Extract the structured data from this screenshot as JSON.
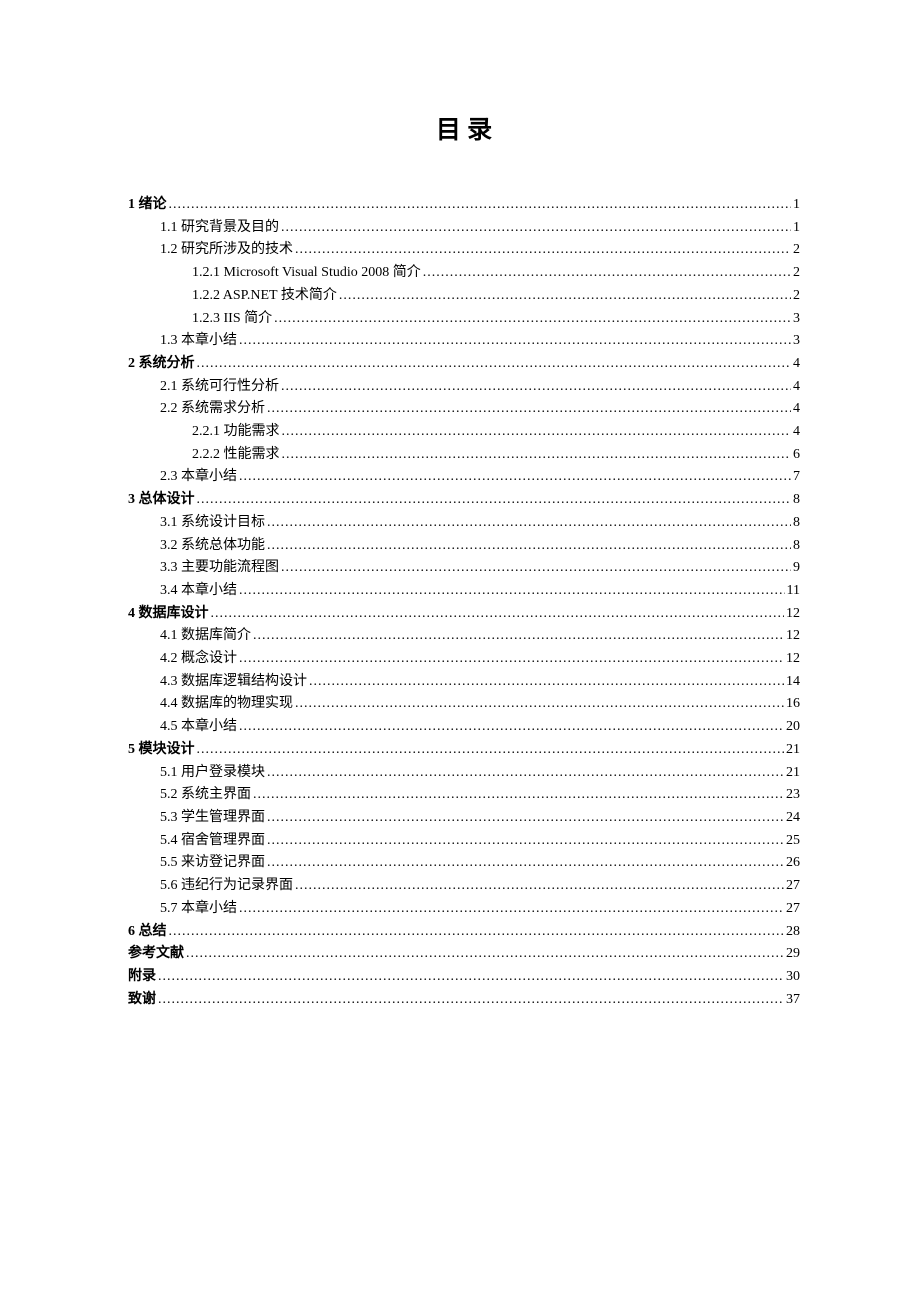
{
  "title": "目 录",
  "toc": [
    {
      "level": 0,
      "label": "1  绪论",
      "page": "1"
    },
    {
      "level": 1,
      "label": "1.1  研究背景及目的",
      "page": "1"
    },
    {
      "level": 1,
      "label": "1.2  研究所涉及的技术",
      "page": "2"
    },
    {
      "level": 2,
      "label": "1.2.1 Microsoft Visual Studio 2008 简介",
      "page": "2"
    },
    {
      "level": 2,
      "label": "1.2.2 ASP.NET 技术简介",
      "page": "2"
    },
    {
      "level": 2,
      "label": "1.2.3 IIS 简介",
      "page": "3"
    },
    {
      "level": 1,
      "label": "1.3  本章小结",
      "page": "3"
    },
    {
      "level": 0,
      "label": "2  系统分析",
      "page": "4"
    },
    {
      "level": 1,
      "label": "2.1  系统可行性分析",
      "page": "4"
    },
    {
      "level": 1,
      "label": "2.2  系统需求分析",
      "page": "4"
    },
    {
      "level": 2,
      "label": "2.2.1  功能需求",
      "page": "4"
    },
    {
      "level": 2,
      "label": "2.2.2  性能需求",
      "page": "6"
    },
    {
      "level": 1,
      "label": "2.3  本章小结",
      "page": "7"
    },
    {
      "level": 0,
      "label": "3  总体设计",
      "page": "8"
    },
    {
      "level": 1,
      "label": "3.1  系统设计目标",
      "page": "8"
    },
    {
      "level": 1,
      "label": "3.2  系统总体功能",
      "page": "8"
    },
    {
      "level": 1,
      "label": "3.3  主要功能流程图",
      "page": "9"
    },
    {
      "level": 1,
      "label": "3.4  本章小结",
      "page": "11"
    },
    {
      "level": 0,
      "label": "4  数据库设计",
      "page": "12"
    },
    {
      "level": 1,
      "label": "4.1  数据库简介",
      "page": "12"
    },
    {
      "level": 1,
      "label": "4.2  概念设计",
      "page": "12"
    },
    {
      "level": 1,
      "label": "4.3  数据库逻辑结构设计",
      "page": "14"
    },
    {
      "level": 1,
      "label": "4.4  数据库的物理实现",
      "page": "16"
    },
    {
      "level": 1,
      "label": "4.5  本章小结",
      "page": "20"
    },
    {
      "level": 0,
      "label": "5  模块设计",
      "page": "21"
    },
    {
      "level": 1,
      "label": "5.1  用户登录模块",
      "page": "21"
    },
    {
      "level": 1,
      "label": "5.2  系统主界面",
      "page": "23"
    },
    {
      "level": 1,
      "label": "5.3  学生管理界面",
      "page": "24"
    },
    {
      "level": 1,
      "label": "5.4  宿舍管理界面",
      "page": "25"
    },
    {
      "level": 1,
      "label": "5.5  来访登记界面",
      "page": "26"
    },
    {
      "level": 1,
      "label": "5.6  违纪行为记录界面",
      "page": "27"
    },
    {
      "level": 1,
      "label": "5.7  本章小结",
      "page": "27"
    },
    {
      "level": 0,
      "label": "6  总结",
      "page": "28"
    },
    {
      "level": 0,
      "label": "参考文献",
      "page": "29"
    },
    {
      "level": 0,
      "label": "附录",
      "page": "30"
    },
    {
      "level": 0,
      "label": "致谢",
      "page": "37"
    }
  ]
}
